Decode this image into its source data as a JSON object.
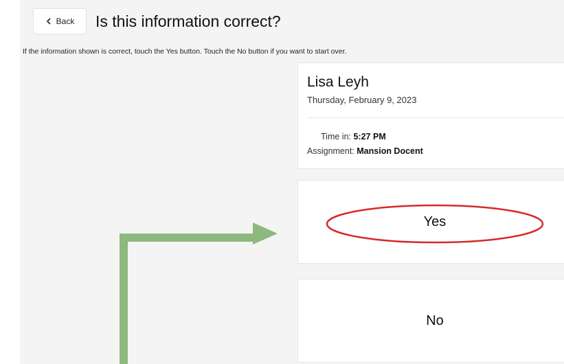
{
  "header": {
    "back_label": "Back",
    "title": "Is this information correct?"
  },
  "instructions": "If the information shown is correct, touch the Yes button. Touch the No button if you want to start over.",
  "info": {
    "name": "Lisa Leyh",
    "date": "Thursday, February 9, 2023",
    "time_in_label": "Time in:",
    "time_in_value": "5:27 PM",
    "assignment_label": "Assignment:",
    "assignment_value": "Mansion Docent"
  },
  "buttons": {
    "yes": "Yes",
    "no": "No"
  },
  "annotations": {
    "highlight_color": "#d62a2a",
    "arrow_color": "#8db87e"
  }
}
